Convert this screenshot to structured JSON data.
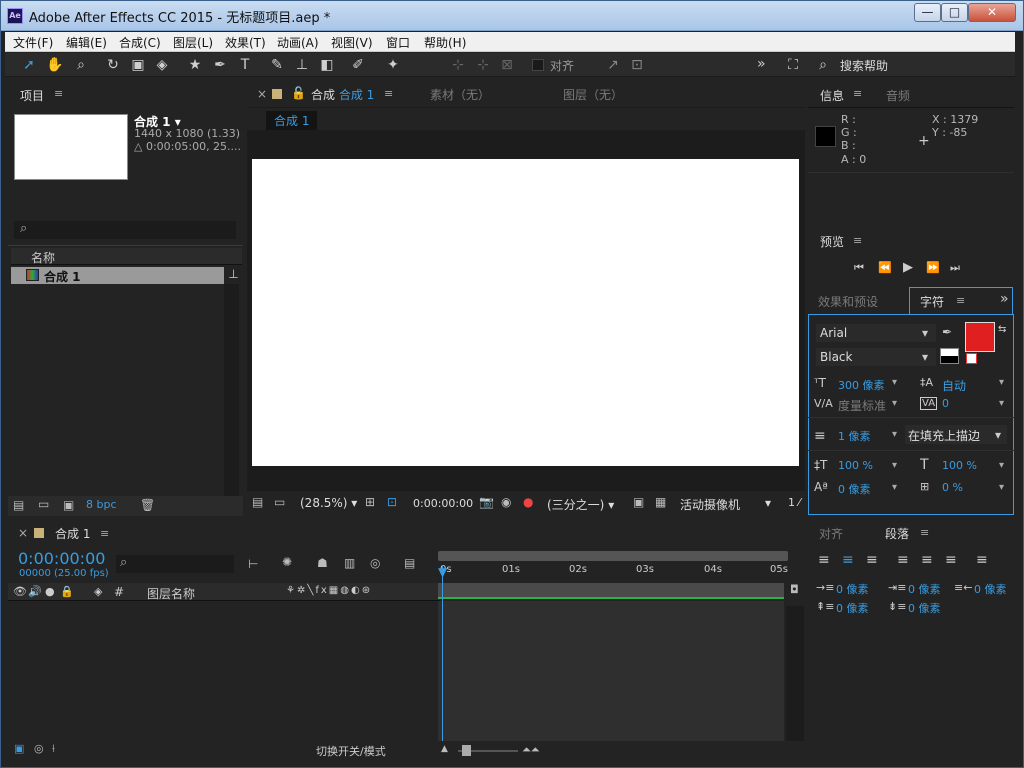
{
  "window": {
    "title": "Adobe After Effects CC 2015 - 无标题项目.aep *",
    "app_icon": "Ae",
    "minimize": "—",
    "maximize": "□",
    "close": "✕"
  },
  "menu": [
    "文件(F)",
    "编辑(E)",
    "合成(C)",
    "图层(L)",
    "效果(T)",
    "动画(A)",
    "视图(V)",
    "窗口",
    "帮助(H)"
  ],
  "toolbar": {
    "align_label": "对齐",
    "search_help": "搜索帮助",
    "more": "»"
  },
  "project": {
    "tab": "项目",
    "comp_name": "合成 1 ▾",
    "comp_size": "1440 x 1080 (1.33)",
    "comp_duration": "△ 0:00:05:00, 25....",
    "col_name": "名称",
    "item_name": "合成 1",
    "bpc": "8 bpc"
  },
  "composition": {
    "tab_prefix": "合成",
    "tab_comp": "合成 1",
    "tab_footage": "素材（无）",
    "tab_layer": "图层（无）",
    "breadcrumb": "合成 1",
    "zoom": "(28.5%)",
    "timecode": "0:00:00:00",
    "resolution": "(三分之一)",
    "camera": "活动摄像机",
    "views": "1 ⁄"
  },
  "info": {
    "tab": "信息",
    "audio_tab": "音频",
    "r": "R :",
    "g": "G :",
    "b": "B :",
    "a": "A : 0",
    "x": "X : 1379",
    "y": "Y : -85"
  },
  "preview": {
    "tab": "预览"
  },
  "character": {
    "effects_tab": "效果和预设",
    "tab": "字符",
    "font": "Arial",
    "style": "Black",
    "size": "300 像素",
    "leading": "自动",
    "kerning": "度量标准",
    "tracking": "0",
    "stroke_width": "1 像素",
    "stroke_mode": "在填充上描边",
    "vscale": "100 %",
    "hscale": "100 %",
    "baseline": "0 像素",
    "tsume": "0 %",
    "fill_color": "#e02020"
  },
  "paragraph": {
    "align_tab": "对齐",
    "tab": "段落",
    "indent_left": "0 像素",
    "indent_first": "0 像素",
    "indent_right": "0 像素",
    "space_before": "0 像素",
    "space_after": "0 像素"
  },
  "timeline": {
    "tab": "合成 1",
    "timecode": "0:00:00:00",
    "frames": "00000 (25.00 fps)",
    "layer_name_col": "图层名称",
    "hash_col": "#",
    "ruler": [
      "0s",
      "01s",
      "02s",
      "03s",
      "04s",
      "05s"
    ],
    "switch_mode": "切换开关/模式"
  }
}
